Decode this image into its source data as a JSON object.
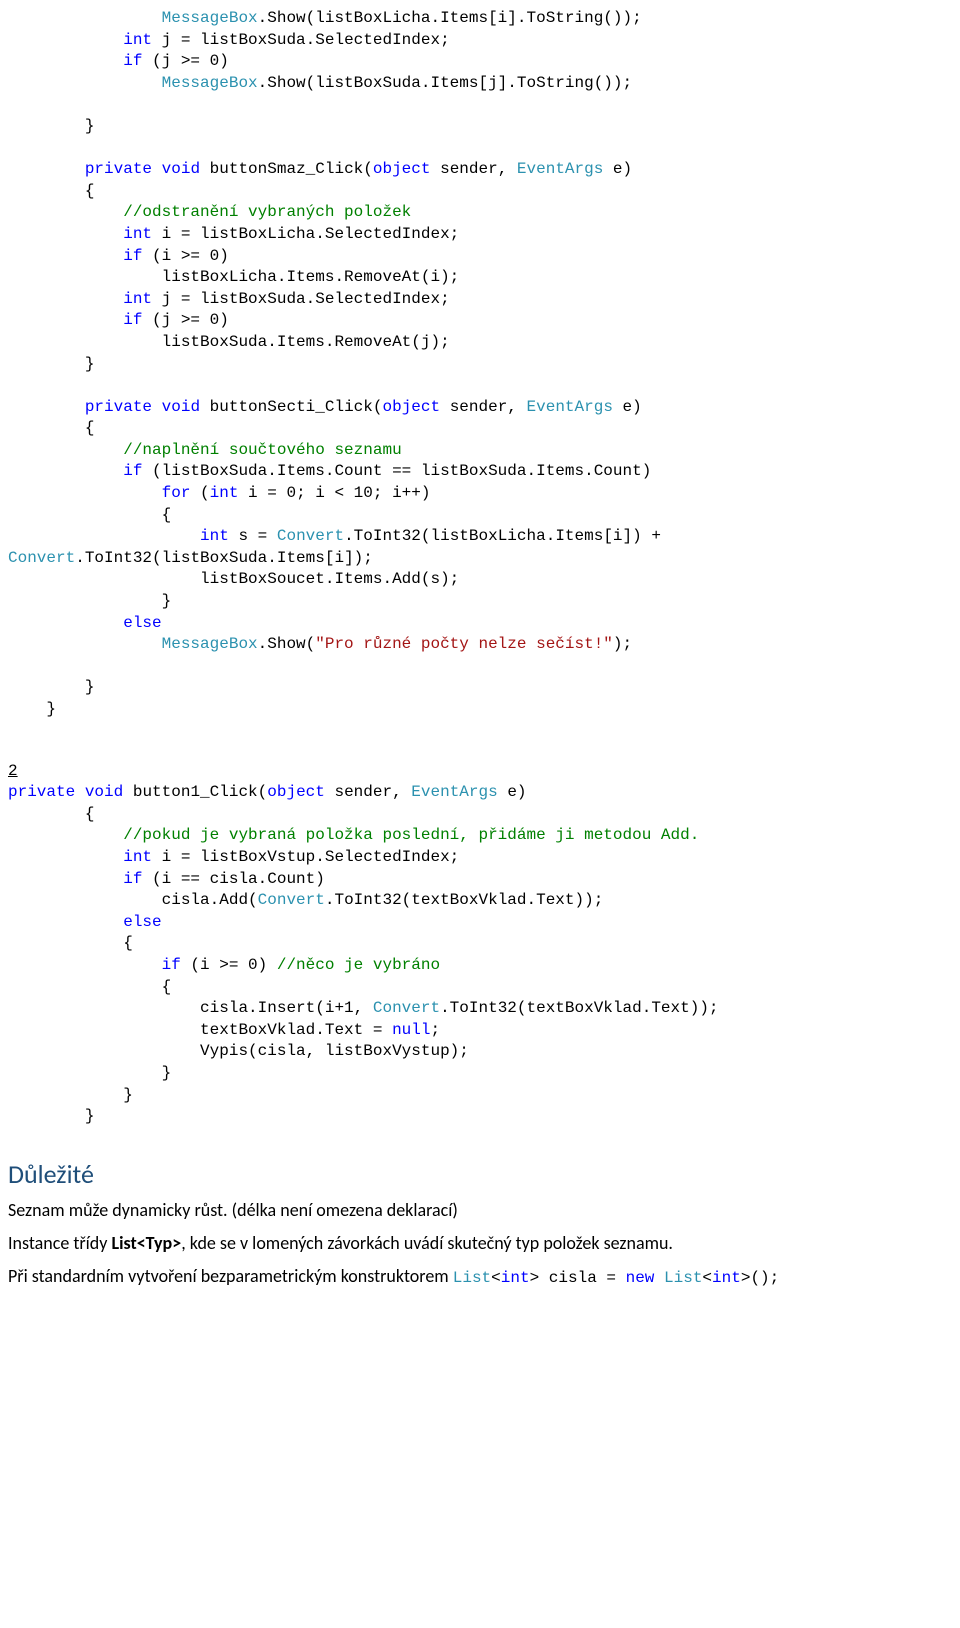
{
  "code1": {
    "l1a": "MessageBox",
    "l1b": ".Show(listBoxLicha.Items[i].ToString());",
    "l2a": "int",
    "l2b": " j = listBoxSuda.SelectedIndex;",
    "l3a": "if",
    "l3b": " (j >= 0)",
    "l4a": "MessageBox",
    "l4b": ".Show(listBoxSuda.Items[j].ToString());",
    "brace": "}",
    "m1a": "private",
    "m1b": " ",
    "m1c": "void",
    "m1d": " buttonSmaz_Click(",
    "m1e": "object",
    "m1f": " sender, ",
    "m1g": "EventArgs",
    "m1h": " e)",
    "obrace": "{",
    "c1": "//odstranění vybraných položek",
    "l5a": "int",
    "l5b": " i = listBoxLicha.SelectedIndex;",
    "l6a": "if",
    "l6b": " (i >= 0)",
    "l7": "listBoxLicha.Items.RemoveAt(i);",
    "l8a": "int",
    "l8b": " j = listBoxSuda.SelectedIndex;",
    "l9a": "if",
    "l9b": " (j >= 0)",
    "l10": "listBoxSuda.Items.RemoveAt(j);",
    "m2a": "private",
    "m2b": " ",
    "m2c": "void",
    "m2d": " buttonSecti_Click(",
    "m2e": "object",
    "m2f": " sender, ",
    "m2g": "EventArgs",
    "m2h": " e)",
    "c2": "//naplnění součtového seznamu",
    "l11a": "if",
    "l11b": " (listBoxSuda.Items.Count == listBoxSuda.Items.Count)",
    "l12a": "for",
    "l12b": " (",
    "l12c": "int",
    "l12d": " i = 0; i < 10; i++)",
    "l13a": "int",
    "l13b": " s = ",
    "l13c": "Convert",
    "l13d": ".ToInt32(listBoxLicha.Items[i]) + ",
    "l14a": "Convert",
    "l14b": ".ToInt32(listBoxSuda.Items[i]);",
    "l15": "listBoxSoucet.Items.Add(s);",
    "l16": "else",
    "l17a": "MessageBox",
    "l17b": ".Show(",
    "l17c": "\"Pro různé počty nelze sečíst!\"",
    "l17d": ");"
  },
  "section2": "2",
  "code2": {
    "m1a": "private",
    "m1b": " ",
    "m1c": "void",
    "m1d": " button1_Click(",
    "m1e": "object",
    "m1f": " sender, ",
    "m1g": "EventArgs",
    "m1h": " e)",
    "obrace": "{",
    "c1": "//pokud je vybraná položka poslední, přidáme ji metodou Add.",
    "l1a": "int",
    "l1b": " i = listBoxVstup.SelectedIndex;",
    "l2a": "if",
    "l2b": " (i == cisla.Count)",
    "l3a": "cisla.Add(",
    "l3b": "Convert",
    "l3c": ".ToInt32(textBoxVklad.Text));",
    "l4": "else",
    "l5a": "if",
    "l5b": " (i >= 0) ",
    "l5c": "//něco je vybráno",
    "l6a": "cisla.Insert(i+1, ",
    "l6b": "Convert",
    "l6c": ".ToInt32(textBoxVklad.Text));",
    "l7a": "textBoxVklad.Text = ",
    "l7b": "null",
    "l7c": ";",
    "l8": "Vypis(cisla, listBoxVystup);",
    "cbrace": "}"
  },
  "heading": "Důležité",
  "para1": "Seznam může dynamicky růst. (délka není omezena deklarací)",
  "para2a": "Instance třídy ",
  "para2b": "List<Typ>",
  "para2c": ", kde se v lomených závorkách uvádí skutečný typ položek seznamu.",
  "para3a": "Při standardním vytvoření bezparametrickým konstruktorem ",
  "para3b": "List",
  "para3c": "<",
  "para3d": "int",
  "para3e": "> cisla = ",
  "para3f": "new",
  "para3g": " ",
  "para3h": "List",
  "para3i": "<",
  "para3j": "int",
  "para3k": ">();"
}
